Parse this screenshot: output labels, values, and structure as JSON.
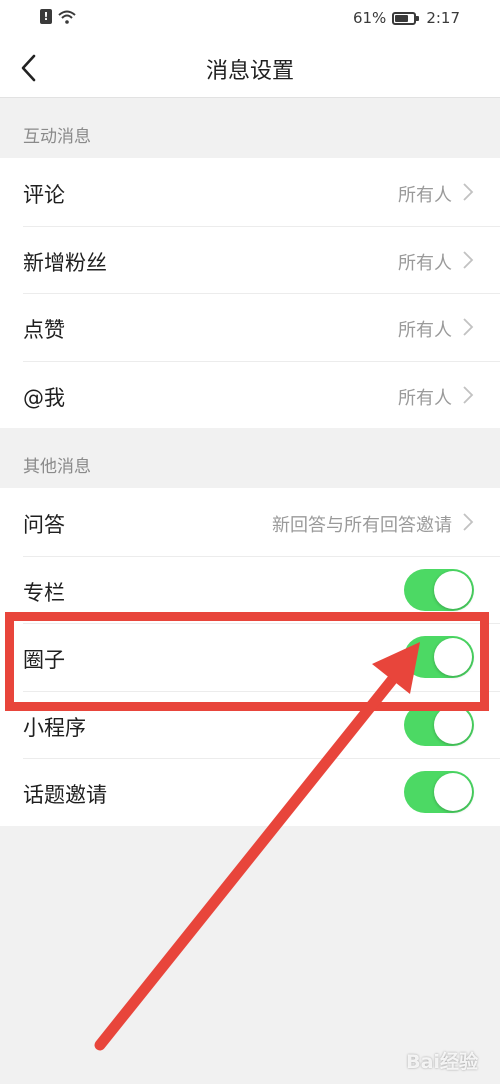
{
  "status_bar": {
    "battery_percent": "61%",
    "time": "2:17",
    "battery_level": 0.61
  },
  "nav": {
    "title": "消息设置"
  },
  "sections": [
    {
      "header": "互动消息",
      "rows": [
        {
          "label": "评论",
          "value": "所有人"
        },
        {
          "label": "新增粉丝",
          "value": "所有人"
        },
        {
          "label": "点赞",
          "value": "所有人"
        },
        {
          "label": "@我",
          "value": "所有人"
        }
      ]
    },
    {
      "header": "其他消息",
      "rows": [
        {
          "label": "问答",
          "value": "新回答与所有回答邀请"
        },
        {
          "label": "专栏",
          "toggle": true
        },
        {
          "label": "圈子",
          "toggle": true
        },
        {
          "label": "小程序",
          "toggle": true
        },
        {
          "label": "话题邀请",
          "toggle": true
        }
      ]
    }
  ],
  "colors": {
    "toggle_on": "#4cd964",
    "annotation": "#e8453b",
    "background": "#f1f1f1"
  },
  "watermark": "Bai经验"
}
